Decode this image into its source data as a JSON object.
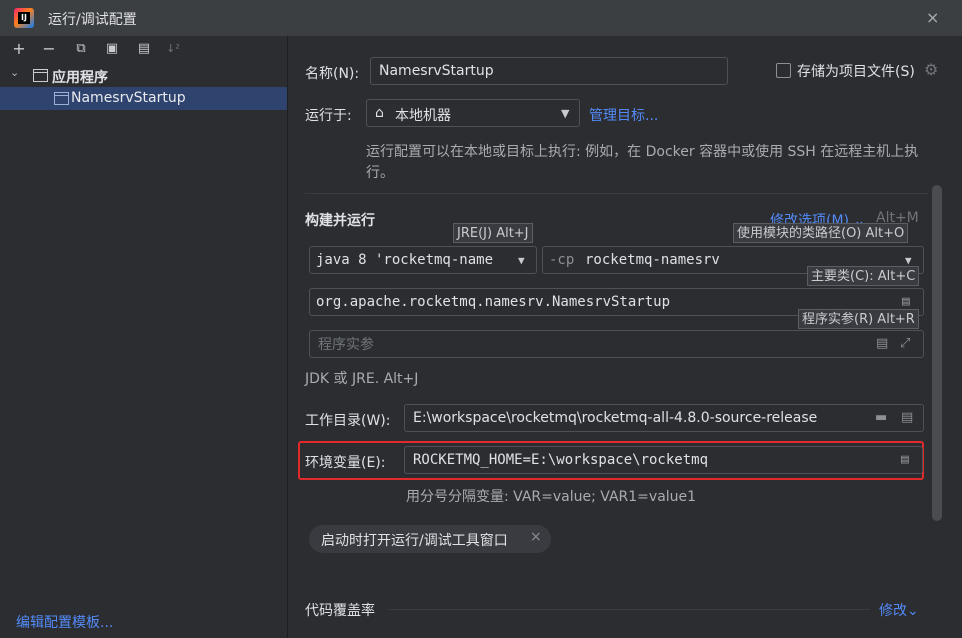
{
  "window": {
    "title": "运行/调试配置",
    "close_glyph": "×"
  },
  "left_panel": {
    "toolbar": [
      {
        "name": "add-icon",
        "glyph": "+"
      },
      {
        "name": "remove-icon",
        "glyph": "−"
      },
      {
        "name": "copy-icon",
        "glyph": "⧉"
      },
      {
        "name": "save-icon",
        "glyph": "▣"
      },
      {
        "name": "move-into-folder-icon",
        "glyph": "▤"
      },
      {
        "name": "sort-icon",
        "glyph": "↓²"
      }
    ],
    "tree": {
      "group_label": "应用程序",
      "selected_item": "NamesrvStartup"
    },
    "edit_templates_link": "编辑配置模板..."
  },
  "form": {
    "name_label": "名称(N):",
    "name_value": "NamesrvStartup",
    "store_as_file_label": "存储为项目文件(S)",
    "run_on_label": "运行于:",
    "run_on_value": "本地机器",
    "manage_targets_link": "管理目标...",
    "run_on_description": "运行配置可以在本地或目标上执行: 例如，在 Docker 容器中或使用 SSH 在远程主机上执行。",
    "build_run_title": "构建并运行",
    "modify_options_link": "修改选项(M) ⌄",
    "modify_options_shortcut": "Alt+M",
    "jre_hint": "JRE(J) Alt+J",
    "classpath_hint": "使用模块的类路径(O) Alt+O",
    "jdk_value": "java 8 'rocketmq-name",
    "classpath_prefix": "-cp",
    "classpath_module": "rocketmq-namesrv",
    "main_class_hint": "主要类(C): Alt+C",
    "main_class_value": "org.apache.rocketmq.namesrv.NamesrvStartup",
    "program_args_hint": "程序实参(R) Alt+R",
    "program_args_placeholder": "程序实参",
    "jdk_tip": "JDK 或 JRE. Alt+J",
    "working_dir_label": "工作目录(W):",
    "working_dir_value": "E:\\workspace\\rocketmq\\rocketmq-all-4.8.0-source-release",
    "env_label": "环境变量(E):",
    "env_value": "ROCKETMQ_HOME=E:\\workspace\\rocketmq",
    "env_hint": "用分号分隔变量: VAR=value; VAR1=value1",
    "open_tool_window_chip": "启动时打开运行/调试工具窗口",
    "coverage_label": "代码覆盖率",
    "coverage_modify_link": "修改⌄"
  },
  "colors": {
    "accent_link": "#548af7",
    "highlight_border": "#e22a2a",
    "selection": "#2e436e"
  }
}
